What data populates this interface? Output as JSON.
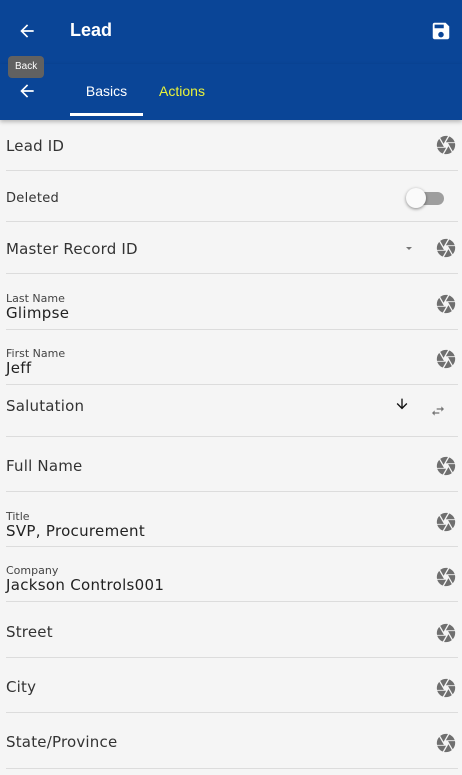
{
  "app_bar": {
    "title": "Lead",
    "back_tooltip": "Back",
    "icons": {
      "back": "arrow-left-icon",
      "save": "floppy-disk-icon"
    },
    "colors": {
      "primary": "#0a4597",
      "active_tab": "#ffffff",
      "inactive_tab": "#e9f23a"
    }
  },
  "tabs": [
    {
      "label": "Basics",
      "active": true
    },
    {
      "label": "Actions",
      "active": false
    }
  ],
  "fields": {
    "lead_id": {
      "label": "Lead ID"
    },
    "deleted": {
      "label": "Deleted",
      "on": false
    },
    "master_record_id": {
      "label": "Master Record ID"
    },
    "last_name": {
      "label": "Last Name",
      "value": "Glimpse"
    },
    "first_name": {
      "label": "First Name",
      "value": "Jeff"
    },
    "salutation": {
      "label": "Salutation"
    },
    "full_name": {
      "label": "Full Name"
    },
    "title": {
      "label": "Title",
      "value": "SVP, Procurement"
    },
    "company": {
      "label": "Company",
      "value": "Jackson Controls001"
    },
    "street": {
      "label": "Street"
    },
    "city": {
      "label": "City"
    },
    "state_province": {
      "label": "State/Province"
    }
  },
  "icons": {
    "field_action": "aperture-icon",
    "sort": "arrow-down-icon",
    "swap": "swap-arrows-icon",
    "dropdown": "caret-down-icon"
  }
}
